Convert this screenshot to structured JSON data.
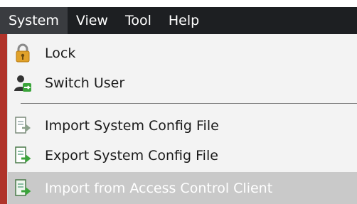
{
  "menubar": {
    "items": [
      {
        "label": "System",
        "active": true
      },
      {
        "label": "View"
      },
      {
        "label": "Tool"
      },
      {
        "label": "Help"
      }
    ]
  },
  "dropdown": {
    "items": [
      {
        "label": "Lock",
        "icon": "padlock-icon",
        "enabled": true
      },
      {
        "label": "Switch User",
        "icon": "switch-user-icon",
        "enabled": true
      },
      {
        "label": "Import System Config File",
        "icon": "import-config-icon",
        "enabled": true
      },
      {
        "label": "Export System Config File",
        "icon": "export-config-icon",
        "enabled": true
      },
      {
        "label": "Import from Access Control Client",
        "icon": "import-access-icon",
        "enabled": false
      }
    ]
  },
  "colors": {
    "menubar_bg": "#1d1f22",
    "menubar_active": "#3a3c40",
    "dropdown_bg": "#f3f3f3",
    "disabled_bg": "#c9c9c9",
    "icon_green": "#3aa43a",
    "lock_gold": "#e1a22a"
  }
}
